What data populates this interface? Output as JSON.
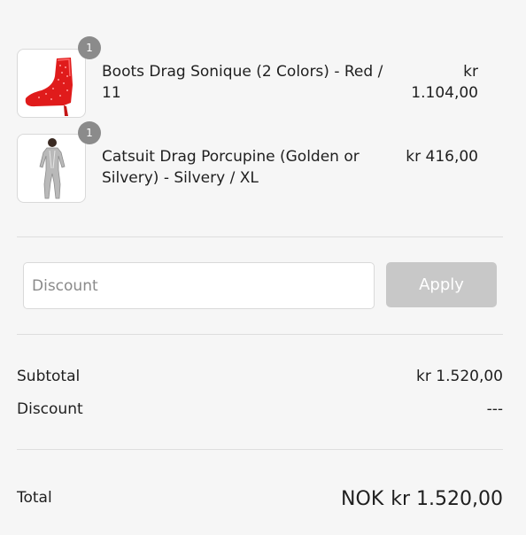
{
  "cart": {
    "items": [
      {
        "quantity": "1",
        "name": "Boots Drag Sonique (2 Colors) - Red / 11",
        "price_line1": "kr",
        "price_line2": "1.104,00",
        "image_icon": "red-spiked-boot-image"
      },
      {
        "quantity": "1",
        "name": "Catsuit Drag Porcupine (Golden or Silvery) - Silvery / XL",
        "price_line1": "kr 416,00",
        "price_line2": "",
        "image_icon": "silver-catsuit-image"
      }
    ]
  },
  "discount": {
    "placeholder": "Discount",
    "apply_label": "Apply"
  },
  "summary": {
    "subtotal_label": "Subtotal",
    "subtotal_value": "kr 1.520,00",
    "discount_label": "Discount",
    "discount_value": "---"
  },
  "total": {
    "label": "Total",
    "currency": "NOK",
    "amount": "kr 1.520,00"
  },
  "colors": {
    "background": "#f6f6f6",
    "badge": "#8b8b8b",
    "apply_button": "#c8c8c8",
    "boot_red": "#e01b1b",
    "catsuit_silver": "#b9b9b9"
  }
}
